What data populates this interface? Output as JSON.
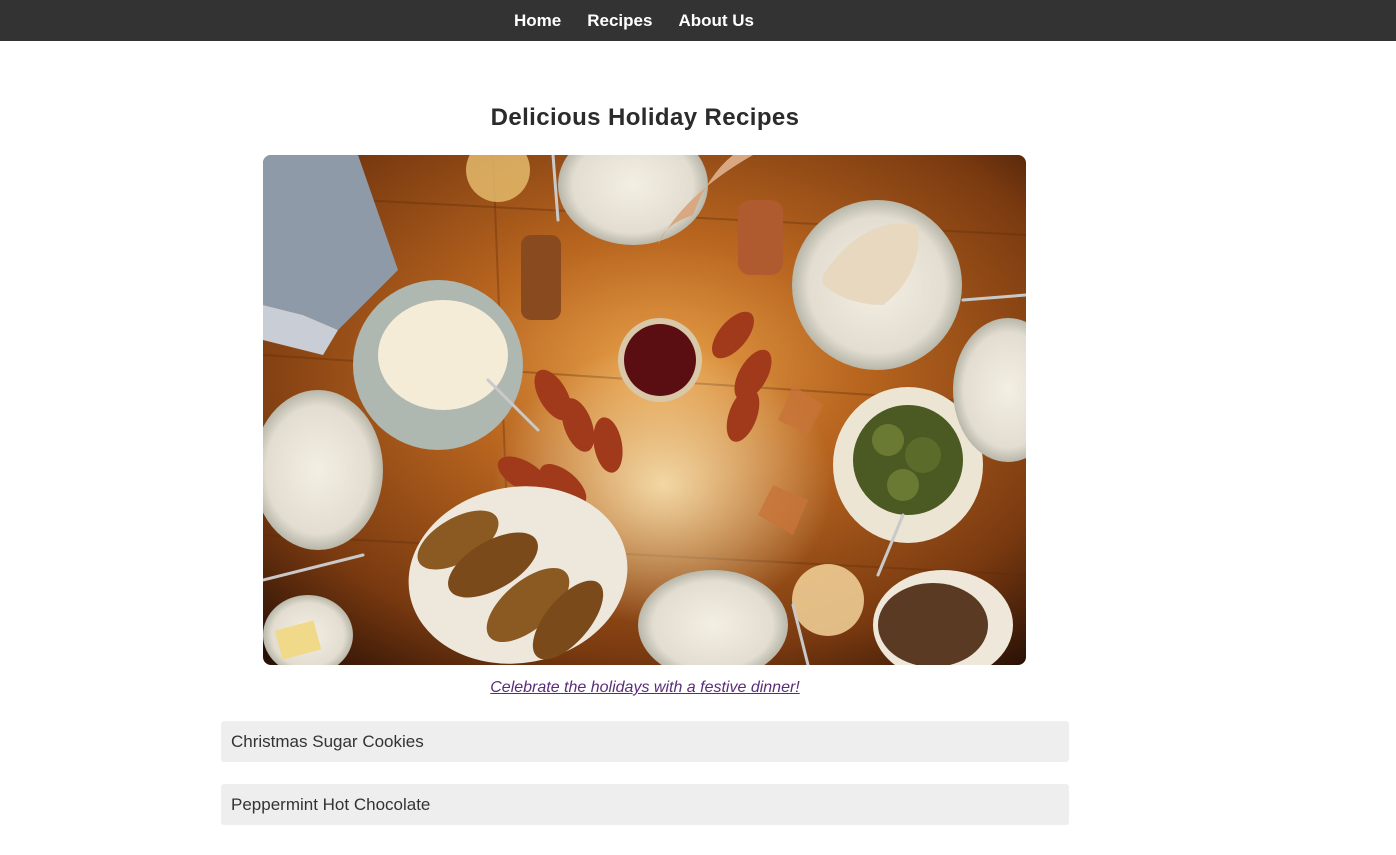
{
  "nav": {
    "items": [
      {
        "label": "Home"
      },
      {
        "label": "Recipes"
      },
      {
        "label": "About Us"
      }
    ]
  },
  "main": {
    "title": "Delicious Holiday Recipes",
    "hero_image": {
      "icon": "holiday-dinner-table-photo"
    },
    "caption": "Celebrate the holidays with a festive dinner!",
    "recipes": [
      {
        "label": "Christmas Sugar Cookies"
      },
      {
        "label": "Peppermint Hot Chocolate"
      }
    ]
  },
  "colors": {
    "nav_bg": "#333333",
    "nav_text": "#ffffff",
    "caption_link": "#5a2d7a",
    "recipe_bg": "#eeeeee"
  }
}
